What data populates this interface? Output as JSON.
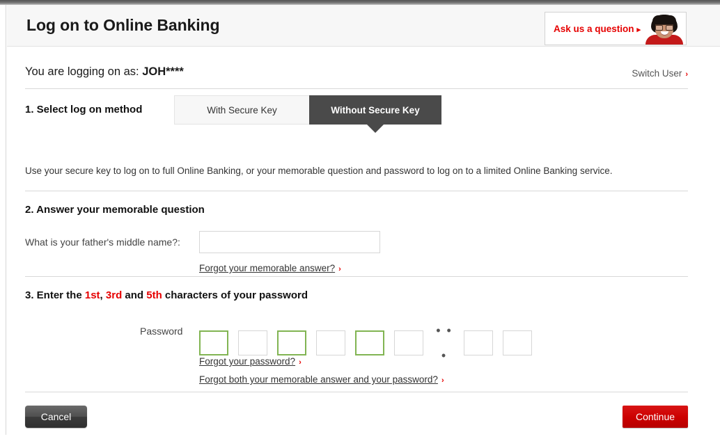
{
  "header": {
    "title": "Log on to Online Banking",
    "ask_widget": {
      "label": "Ask us a question",
      "arrow": "▸"
    }
  },
  "account": {
    "logging_on_prefix": "You are logging on as: ",
    "masked_username": "JOH****",
    "switch_user_label": "Switch User",
    "chevron": "›"
  },
  "section1": {
    "heading": "1. Select log on method",
    "tabs": [
      {
        "label": "With Secure Key",
        "active": false
      },
      {
        "label": "Without Secure Key",
        "active": true
      }
    ],
    "blurb": "Use your secure key to log on to full Online Banking, or your memorable question and password to log on to a limited Online Banking service."
  },
  "section2": {
    "heading": "2. Answer your memorable question",
    "question_label": "What is your father's middle name?:",
    "answer_value": "",
    "answer_placeholder": "",
    "forgot_answer_link": "Forgot your memorable answer?"
  },
  "section3": {
    "heading_parts": {
      "before": "3. Enter the ",
      "first": "1st",
      "sep1": ", ",
      "second": "3rd",
      "sep2": " and ",
      "third": "5th",
      "after": " characters of your password"
    },
    "password_label": "Password",
    "ellipsis": "• • •",
    "boxes": [
      {
        "index": 1,
        "required": true,
        "value": ""
      },
      {
        "index": 2,
        "required": false,
        "value": ""
      },
      {
        "index": 3,
        "required": true,
        "value": ""
      },
      {
        "index": 4,
        "required": false,
        "value": ""
      },
      {
        "index": 5,
        "required": true,
        "value": ""
      },
      {
        "index": 6,
        "required": false,
        "value": ""
      },
      {
        "index": 7,
        "required": false,
        "value": ""
      },
      {
        "index": 8,
        "required": false,
        "value": ""
      }
    ],
    "forgot_password_link": "Forgot your password?",
    "forgot_both_link": "Forgot both your memorable answer and your password?"
  },
  "footer": {
    "cancel_label": "Cancel",
    "continue_label": "Continue"
  },
  "colors": {
    "accent_red": "#e60000",
    "button_red": "#cc0000",
    "active_tab": "#4a4a4a",
    "required_box_green": "#81b452",
    "header_bg": "#f7f7f7"
  }
}
